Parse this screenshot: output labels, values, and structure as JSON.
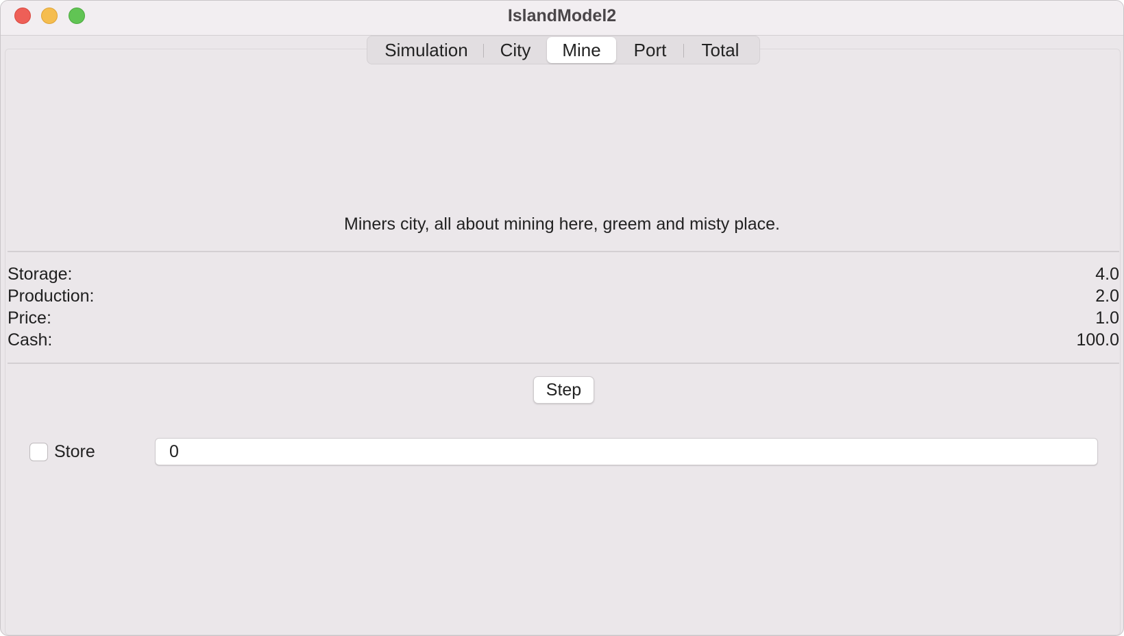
{
  "window": {
    "title": "IslandModel2"
  },
  "tabs": [
    {
      "label": "Simulation",
      "active": false
    },
    {
      "label": "City",
      "active": false
    },
    {
      "label": "Mine",
      "active": true
    },
    {
      "label": "Port",
      "active": false
    },
    {
      "label": "Total",
      "active": false
    }
  ],
  "mine": {
    "description": "Miners city, all about mining here, greem and misty place.",
    "stats": [
      {
        "label": "Storage:",
        "value": "4.0"
      },
      {
        "label": "Production:",
        "value": "2.0"
      },
      {
        "label": "Price:",
        "value": "1.0"
      },
      {
        "label": "Cash:",
        "value": "100.0"
      }
    ],
    "step_label": "Step",
    "store_label": "Store",
    "store_checked": false,
    "store_value": "0"
  },
  "colors": {
    "close": "#ee5f57",
    "minimize": "#f5bd4f",
    "maximize": "#61c454",
    "window_bg": "#ebe7ea"
  }
}
